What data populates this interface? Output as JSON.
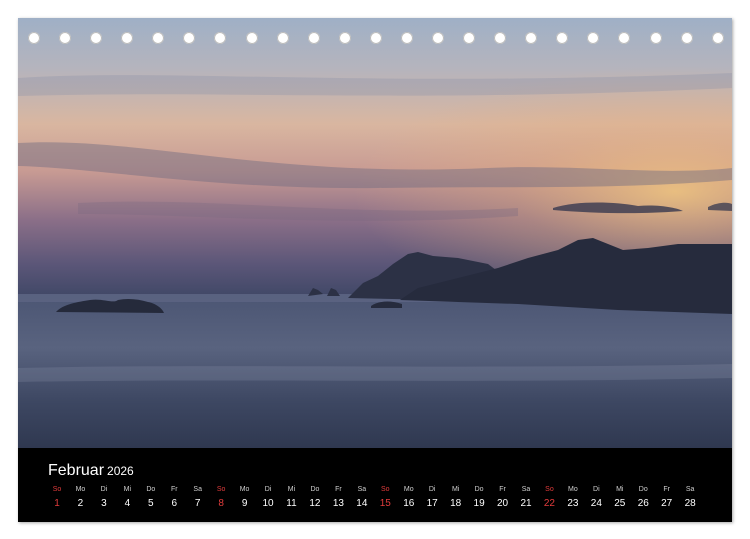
{
  "calendar": {
    "month": "Februar",
    "year": "2026",
    "days": [
      {
        "wd": "So",
        "n": "1",
        "sun": true
      },
      {
        "wd": "Mo",
        "n": "2"
      },
      {
        "wd": "Di",
        "n": "3"
      },
      {
        "wd": "Mi",
        "n": "4"
      },
      {
        "wd": "Do",
        "n": "5"
      },
      {
        "wd": "Fr",
        "n": "6"
      },
      {
        "wd": "Sa",
        "n": "7"
      },
      {
        "wd": "So",
        "n": "8",
        "sun": true
      },
      {
        "wd": "Mo",
        "n": "9"
      },
      {
        "wd": "Di",
        "n": "10"
      },
      {
        "wd": "Mi",
        "n": "11"
      },
      {
        "wd": "Do",
        "n": "12"
      },
      {
        "wd": "Fr",
        "n": "13"
      },
      {
        "wd": "Sa",
        "n": "14"
      },
      {
        "wd": "So",
        "n": "15",
        "sun": true
      },
      {
        "wd": "Mo",
        "n": "16"
      },
      {
        "wd": "Di",
        "n": "17"
      },
      {
        "wd": "Mi",
        "n": "18"
      },
      {
        "wd": "Do",
        "n": "19"
      },
      {
        "wd": "Fr",
        "n": "20"
      },
      {
        "wd": "Sa",
        "n": "21"
      },
      {
        "wd": "So",
        "n": "22",
        "sun": true
      },
      {
        "wd": "Mo",
        "n": "23"
      },
      {
        "wd": "Di",
        "n": "24"
      },
      {
        "wd": "Mi",
        "n": "25"
      },
      {
        "wd": "Do",
        "n": "26"
      },
      {
        "wd": "Fr",
        "n": "27"
      },
      {
        "wd": "Sa",
        "n": "28"
      }
    ]
  },
  "binding": {
    "hole_count": 23
  },
  "colors": {
    "sunday": "#e23c3c",
    "weekday": "#ffffff",
    "bar": "#000000"
  }
}
